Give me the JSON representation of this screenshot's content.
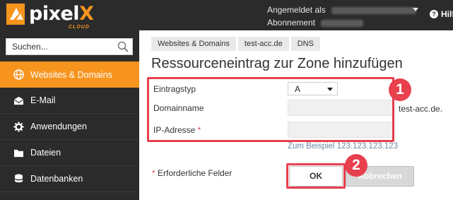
{
  "header": {
    "logo": {
      "text_main": "pixel",
      "text_accent": "X",
      "tagline": "CLOUD",
      "accent_color": "#f7941e"
    },
    "logged_in_label": "Angemeldet als",
    "subscription_label": "Abonnement",
    "help_label": "Hilfe"
  },
  "sidebar": {
    "search_placeholder": "Suchen...",
    "items": [
      {
        "label": "Websites & Domains",
        "icon": "globe-icon",
        "active": true
      },
      {
        "label": "E-Mail",
        "icon": "mail-icon",
        "active": false
      },
      {
        "label": "Anwendungen",
        "icon": "gear-icon",
        "active": false
      },
      {
        "label": "Dateien",
        "icon": "folder-icon",
        "active": false
      },
      {
        "label": "Datenbanken",
        "icon": "database-icon",
        "active": false
      }
    ]
  },
  "breadcrumb": [
    "Websites & Domains",
    "test-acc.de",
    "DNS"
  ],
  "page_title": "Ressourceneintrag zur Zone hinzufügen",
  "form": {
    "record_type": {
      "label": "Eintragstyp",
      "value": "A"
    },
    "domain_name": {
      "label": "Domainname",
      "value": "",
      "suffix": "test-acc.de."
    },
    "ip_address": {
      "label": "IP-Adresse",
      "required_mark": "*",
      "value": "",
      "hint": "Zum Beispiel 123.123.123.123"
    },
    "required_note_mark": "*",
    "required_note": "Erforderliche Felder",
    "ok_label": "OK",
    "cancel_label": "Abbrechen"
  },
  "callouts": {
    "one": "1",
    "two": "2",
    "color": "#e8404d"
  }
}
